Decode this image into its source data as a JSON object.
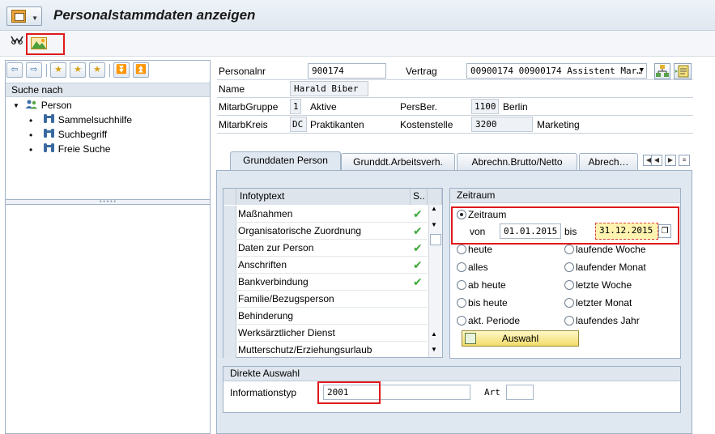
{
  "window": {
    "title": "Personalstammdaten anzeigen"
  },
  "navigation": {
    "header": "Suche nach",
    "tree": {
      "root": "Person",
      "children": [
        "Sammelsuchhilfe",
        "Suchbegriff",
        "Freie Suche"
      ]
    }
  },
  "header": {
    "personalnr_label": "Personalnr",
    "personalnr_value": "900174",
    "vertrag_label": "Vertrag",
    "vertrag_value": "00900174 00900174 Assistent Mar…",
    "name_label": "Name",
    "name_value": "Harald Biber",
    "mitarbgruppe_label": "MitarbGruppe",
    "mitarbgruppe_code": "1",
    "mitarbgruppe_text": "Aktive",
    "persber_label": "PersBer.",
    "persber_code": "1100",
    "persber_text": "Berlin",
    "mitarbkreis_label": "MitarbKreis",
    "mitarbkreis_code": "DC",
    "mitarbkreis_text": "Praktikanten",
    "kostenstelle_label": "Kostenstelle",
    "kostenstelle_code": "3200",
    "kostenstelle_text": "Marketing"
  },
  "tabs": [
    {
      "label": "Grunddaten Person",
      "active": true
    },
    {
      "label": "Grunddt.Arbeitsverh.",
      "active": false
    },
    {
      "label": "Abrechn.Brutto/Netto",
      "active": false
    },
    {
      "label": "Abrech…",
      "active": false
    }
  ],
  "infotypes": {
    "col_text": "Infotyptext",
    "col_status": "S..",
    "rows": [
      {
        "text": "Maßnahmen",
        "done": true
      },
      {
        "text": "Organisatorische Zuordnung",
        "done": true
      },
      {
        "text": "Daten zur Person",
        "done": true
      },
      {
        "text": "Anschriften",
        "done": true
      },
      {
        "text": "Bankverbindung",
        "done": true
      },
      {
        "text": "Familie/Bezugsperson",
        "done": false
      },
      {
        "text": "Behinderung",
        "done": false
      },
      {
        "text": "Werksärztlicher Dienst",
        "done": false
      },
      {
        "text": "Mutterschutz/Erziehungsurlaub",
        "done": false
      }
    ]
  },
  "zeitraum": {
    "group_title": "Zeitraum",
    "radio_label": "Zeitraum",
    "von_label": "von",
    "von_value": "01.01.2015",
    "bis_label": "bis",
    "bis_value": "31.12.2015",
    "options_left": [
      "heute",
      "alles",
      "ab heute",
      "bis heute",
      "akt. Periode"
    ],
    "options_right": [
      "laufende Woche",
      "laufender Monat",
      "letzte Woche",
      "letzter Monat",
      "laufendes Jahr"
    ],
    "button_label": "Auswahl"
  },
  "direkte_auswahl": {
    "group_title": "Direkte Auswahl",
    "infotyp_label": "Informationstyp",
    "infotyp_value": "2001",
    "art_label": "Art",
    "art_value": ""
  },
  "colors": {
    "highlight_red": "#e0191b",
    "panel_blue": "#dfe7f0",
    "check_green": "#3fa93c",
    "date_yellow": "#fff3b0"
  }
}
